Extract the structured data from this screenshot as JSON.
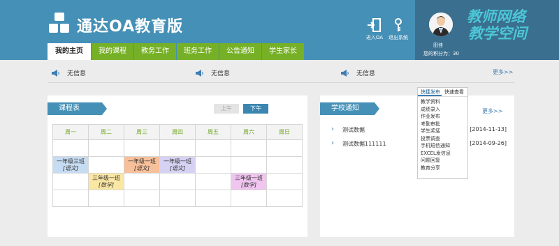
{
  "header": {
    "app_title": "通达OA教育版",
    "enter_oa": "进入OA",
    "logout": "退出系统",
    "user_name": "田佳",
    "user_points": "您的积分为：30",
    "slogan_line1": "教师网络",
    "slogan_line2": "教学空间"
  },
  "nav": {
    "items": [
      "我的主页",
      "我的课程",
      "教务工作",
      "班务工作",
      "公告通知",
      "学生家长"
    ],
    "active_index": 0
  },
  "notices": {
    "items": [
      "无信息",
      "无信息",
      "无信息"
    ],
    "more": "更多>>"
  },
  "schedule": {
    "title": "课程表",
    "am_label": "上午",
    "pm_label": "下午",
    "days": [
      "周一",
      "周二",
      "周三",
      "周四",
      "周五",
      "周六",
      "周日"
    ],
    "rows": [
      [
        "",
        "",
        "",
        "",
        "",
        "",
        ""
      ],
      [
        {
          "class": "一年级三班",
          "subject": "[语文]",
          "color": "#c6dcf2"
        },
        "",
        {
          "class": "一年级一班",
          "subject": "[语文]",
          "color": "#f8c09a"
        },
        {
          "class": "一年级一班",
          "subject": "[语文]",
          "color": "#d6d2f4"
        },
        "",
        "",
        ""
      ],
      [
        "",
        {
          "class": "三年级一班",
          "subject": "[数学]",
          "color": "#fbe7a4"
        },
        "",
        "",
        "",
        {
          "class": "三年级一班",
          "subject": "[数学]",
          "color": "#f0c5ef"
        },
        ""
      ],
      [
        "",
        "",
        "",
        "",
        "",
        "",
        ""
      ]
    ]
  },
  "school_notices": {
    "title": "学校通知",
    "more": "更多>>",
    "items": [
      {
        "title": "测试数据",
        "date": "[2014-11-13]"
      },
      {
        "title": "测试数据111111",
        "date": "[2014-09-26]"
      }
    ]
  },
  "quick_menu": {
    "tabs": [
      "快捷发布",
      "快速查看"
    ],
    "items": [
      "教学资料",
      "成绩录入",
      "作业发布",
      "考勤审批",
      "学生奖惩",
      "投票调查",
      "手机短信通知",
      "EXCEL发信息",
      "问题回复",
      "教育分享"
    ]
  },
  "colors": {
    "header_bg": "#4590b6",
    "nav_green": "#76b027",
    "slogan": "#4cc6d6",
    "link": "#3d7db2"
  }
}
